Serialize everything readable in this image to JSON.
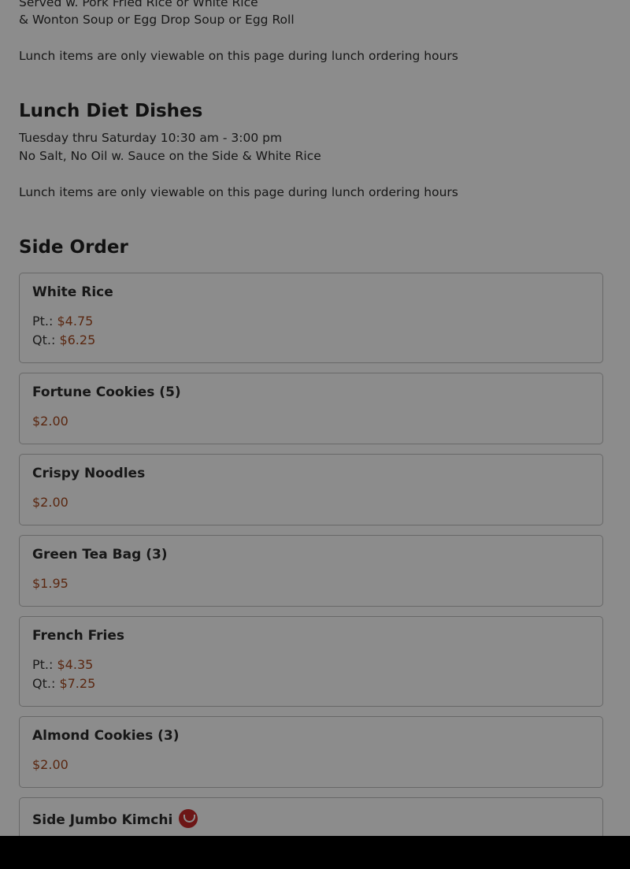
{
  "intro": {
    "line1": "Served w. Pork Fried Rice or White Rice",
    "line2": "& Wonton Soup or Egg Drop Soup or Egg Roll",
    "note": "Lunch items are only viewable on this page during lunch ordering hours"
  },
  "lunch_diet": {
    "title": "Lunch Diet Dishes",
    "hours": "Tuesday thru Saturday 10:30 am - 3:00 pm",
    "desc": "No Salt, No Oil w. Sauce on the Side & White Rice",
    "note": "Lunch items are only viewable on this page during lunch ordering hours"
  },
  "side_order": {
    "title": "Side Order",
    "items": [
      {
        "name": "White Rice",
        "prices": [
          {
            "label": "Pt.:",
            "value": "$4.75"
          },
          {
            "label": "Qt.:",
            "value": "$6.25"
          }
        ]
      },
      {
        "name": "Fortune Cookies (5)",
        "prices": [
          {
            "label": "",
            "value": "$2.00"
          }
        ]
      },
      {
        "name": "Crispy Noodles",
        "prices": [
          {
            "label": "",
            "value": "$2.00"
          }
        ]
      },
      {
        "name": "Green Tea Bag (3)",
        "prices": [
          {
            "label": "",
            "value": "$1.95"
          }
        ]
      },
      {
        "name": "French Fries",
        "prices": [
          {
            "label": "Pt.:",
            "value": "$4.35"
          },
          {
            "label": "Qt.:",
            "value": "$7.25"
          }
        ]
      },
      {
        "name": "Almond Cookies (3)",
        "prices": [
          {
            "label": "",
            "value": "$2.00"
          }
        ]
      },
      {
        "name": "Side Jumbo Kimchi",
        "spicy_icon": "chili-pepper-icon"
      }
    ]
  },
  "colors": {
    "price": "#a4471e",
    "spicy": "#c62828",
    "overlay": "rgba(0,0,0,0.45)"
  }
}
